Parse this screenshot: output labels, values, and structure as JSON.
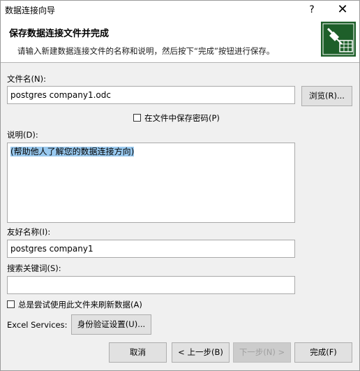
{
  "window": {
    "title": "数据连接向导",
    "help_glyph": "?",
    "close_glyph": "✕"
  },
  "header": {
    "title": "保存数据连接文件并完成",
    "subtitle": "请输入新建数据连接文件的名称和说明，然后按下“完成”按钮进行保存。",
    "icon": "data-connection-plug-icon"
  },
  "file_name": {
    "label": "文件名(N):",
    "value": "postgres company1.odc",
    "browse_label": "浏览(R)..."
  },
  "save_password": {
    "label": "在文件中保存密码(P)",
    "checked": false
  },
  "description": {
    "label": "说明(D):",
    "value": "(帮助他人了解您的数据连接方向)"
  },
  "friendly_name": {
    "label": "友好名称(I):",
    "value": "postgres company1"
  },
  "keywords": {
    "label": "搜索关键词(S):",
    "value": ""
  },
  "always_refresh": {
    "label": "总是尝试使用此文件来刷新数据(A)",
    "checked": false
  },
  "excel_services": {
    "label": "Excel Services:",
    "button_label": "身份验证设置(U)..."
  },
  "footer": {
    "cancel_label": "取消",
    "back_label": "< 上一步(B)",
    "next_label": "下一步(N) >",
    "finish_label": "完成(F)"
  },
  "colors": {
    "header_icon_bg": "#1e5f2a",
    "selection": "#99c9ef"
  }
}
